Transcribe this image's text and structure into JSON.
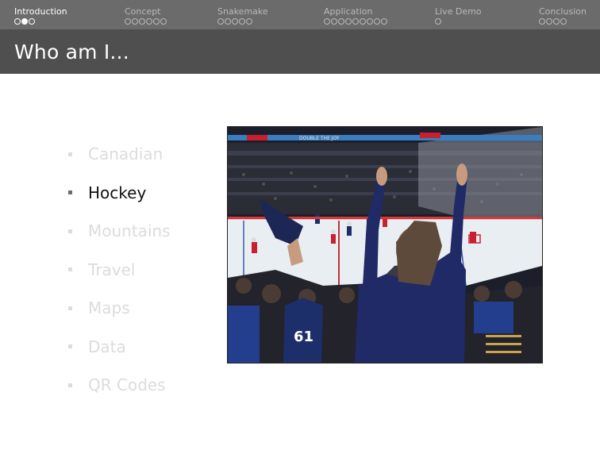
{
  "nav": {
    "sections": [
      {
        "label": "Introduction",
        "dots": 3,
        "filled": 1,
        "active": true
      },
      {
        "label": "Concept",
        "dots": 6,
        "filled": -1,
        "active": false
      },
      {
        "label": "Snakemake",
        "dots": 5,
        "filled": -1,
        "active": false
      },
      {
        "label": "Application",
        "dots": 9,
        "filled": -1,
        "active": false
      },
      {
        "label": "Live Demo",
        "dots": 1,
        "filled": -1,
        "active": false
      },
      {
        "label": "Conclusion",
        "dots": 4,
        "filled": -1,
        "active": false
      }
    ]
  },
  "frame": {
    "title": "Who am I..."
  },
  "bullets": [
    {
      "text": "Canadian",
      "current": false
    },
    {
      "text": "Hockey",
      "current": true
    },
    {
      "text": "Mountains",
      "current": false
    },
    {
      "text": "Travel",
      "current": false
    },
    {
      "text": "Maps",
      "current": false
    },
    {
      "text": "Data",
      "current": false
    },
    {
      "text": "QR Codes",
      "current": false
    }
  ],
  "photo": {
    "banner_text": "DOUBLE THE JOY",
    "jersey_number": "61"
  },
  "colors": {
    "nav_bg": "#6b6b6b",
    "title_bg": "#4f4f4f",
    "inactive": "#dcdcdc"
  }
}
